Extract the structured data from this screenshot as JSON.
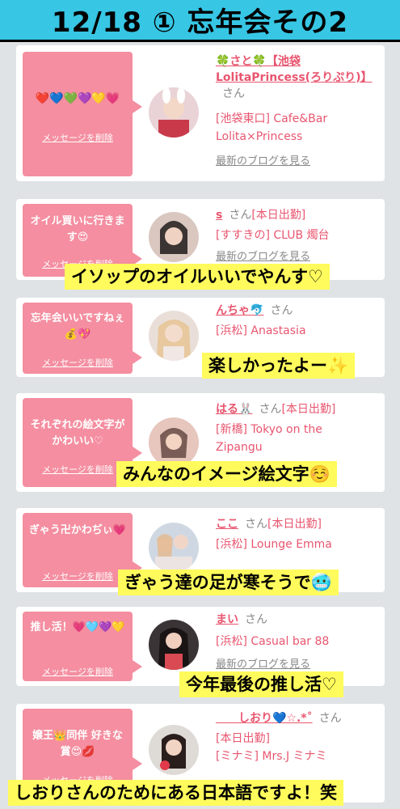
{
  "header": {
    "title": "12/18 ① 忘年会その2"
  },
  "common": {
    "delete_label": "メッセージを削除",
    "blog_label": "最新のブログを見る",
    "san": "さん"
  },
  "cards": [
    {
      "message": "❤️💙💚💜💛💗",
      "name": "🍀さと🍀【池袋LolitaPrincess(ろりぷり)】",
      "status": "",
      "shop_lines": [
        "[池袋東口] Cafe&Bar",
        "Lolita×Princess"
      ],
      "caption": ""
    },
    {
      "message": "オイル買いに行きます😍",
      "name": "s",
      "status": "[本日出勤]",
      "shop_lines": [
        "[すすきの] CLUB 燭台"
      ],
      "caption": "イソップのオイルいいでやんす♡"
    },
    {
      "message": "忘年会いいですねぇ💰💖",
      "name": "んちゃ🐬",
      "status": "",
      "shop_lines": [
        "[浜松] Anastasia"
      ],
      "caption": "楽しかったよー✨"
    },
    {
      "message": "それぞれの絵文字がかわいい♡",
      "name": "はる🐰",
      "status": "[本日出勤]",
      "shop_lines": [
        "[新橋] Tokyo on the",
        "Zipangu"
      ],
      "caption": "みんなのイメージ絵文字☺️"
    },
    {
      "message": "ぎゃう卍かわぢぃ💗",
      "name": "ここ",
      "status": "[本日出勤]",
      "shop_lines": [
        "[浜松] Lounge Emma"
      ],
      "caption": "ぎゃう達の足が寒そうで🥶"
    },
    {
      "message": "推し活！💗🩵💜💛",
      "name": "まい",
      "status": "",
      "shop_lines": [
        "[浜松] Casual bar 88"
      ],
      "caption": "今年最後の推し活♡"
    },
    {
      "message": "嬢王👑同伴 好きな賞😍💋",
      "name": "　　しおり💙☆.*˚",
      "status": "",
      "shop_lines": [
        "[本日出勤]",
        "[ミナミ] Mrs.J ミナミ"
      ],
      "caption": "しおりさんのためにある日本語ですよ！笑"
    }
  ],
  "colors": {
    "title_bg": "#37c6e4",
    "bubble": "#f48ea0",
    "accent": "#e8566f",
    "caption_bg": "#fffb5c"
  }
}
